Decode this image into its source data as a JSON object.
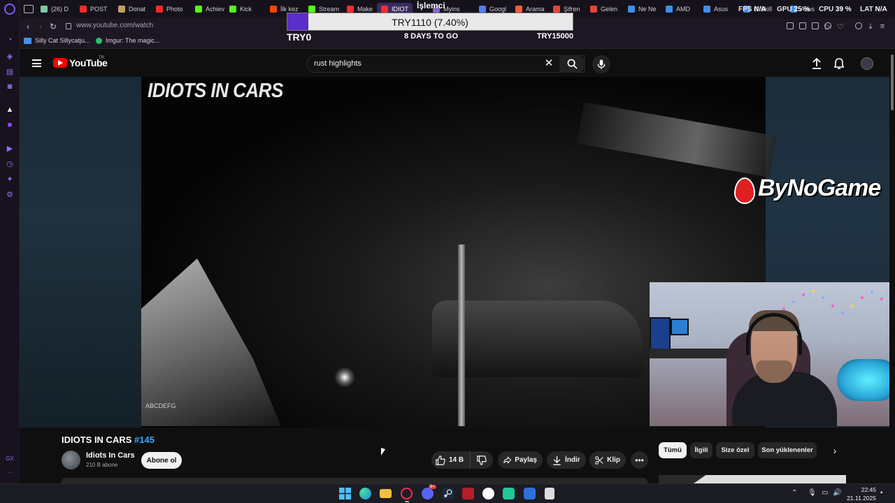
{
  "browser": {
    "tabs": [
      {
        "label": "(26) D",
        "color": "#7ec8a5"
      },
      {
        "label": "POST",
        "color": "#ff2a2a"
      },
      {
        "label": "Donat",
        "color": "#c0a060"
      },
      {
        "label": "Photo",
        "color": "#ff2a2a"
      },
      {
        "label": "Achiev",
        "color": "#53fc18"
      },
      {
        "label": "Kick",
        "color": "#53fc18"
      },
      {
        "label": "İlk kez",
        "color": "#ff4500"
      },
      {
        "label": "Stream",
        "color": "#53fc18"
      },
      {
        "label": "Make",
        "color": "#ff2a2a"
      },
      {
        "label": "IDIOT",
        "color": "#ff2a2a",
        "active": true
      },
      {
        "label": "Myins",
        "color": "#8a63d2"
      },
      {
        "label": "Googl",
        "color": "#4f7cf5"
      },
      {
        "label": "Arama",
        "color": "#ff5c3a"
      },
      {
        "label": "Şifren",
        "color": "#ea4335"
      },
      {
        "label": "Gelen",
        "color": "#ea4335"
      },
      {
        "label": "Ne Ne",
        "color": "#3e8ee8"
      },
      {
        "label": "AMD",
        "color": "#3e8ee8"
      },
      {
        "label": "Asus",
        "color": "#3e8ee8"
      },
      {
        "label": "G Skill",
        "color": "#3e8ee8"
      },
      {
        "label": "Asus",
        "color": "#3e8ee8"
      }
    ],
    "url": "www.youtube.com/watch",
    "bookmarks": [
      {
        "label": "Silly Cat Sillycatju...",
        "color": "#4a8fe8"
      },
      {
        "label": "Imgur: The magic...",
        "color": "#2bbf6a"
      }
    ]
  },
  "overlay": {
    "fps_label": "FPS",
    "fps_value": "N/A",
    "gpu_label": "GPU",
    "gpu_value": "25 %",
    "cpu_label": "CPU",
    "cpu_value": "39 %",
    "lat_label": "LAT",
    "lat_value": "N/A",
    "cpu_tooltip": "İşlemci"
  },
  "donation_goal": {
    "bar_text": "TRY1110 (7.40%)",
    "progress_fraction": 0.074,
    "current": "TRY0",
    "days_left": "8 DAYS TO GO",
    "target": "TRY15000"
  },
  "youtube": {
    "logo_text": "YouTube",
    "country_code": "TR",
    "search_query": "rust highlights",
    "video": {
      "overlay_title": "IDIOTS IN CARS",
      "watermark": "ABCDEFG",
      "streamer_brand": "ByNoGame"
    },
    "title_main": "IDIOTS IN CARS",
    "title_hashtag": "#145",
    "channel_name": "Idiots In Cars",
    "subscribers": "210 B abone",
    "subscribe_label": "Abone ol",
    "likes": "14 B",
    "share_label": "Paylaş",
    "download_label": "İndir",
    "clip_label": "Klip",
    "chips": [
      "Tümü",
      "İlgili",
      "Size özel",
      "Son yüklenenler"
    ]
  },
  "taskbar": {
    "time": "22:45",
    "date": "21.11.2025",
    "discord_badge": "9+"
  },
  "colors": {
    "accent_purple": "#5c2ec8",
    "youtube_red": "#ff0000",
    "gx_purple": "#8f6ff2"
  }
}
